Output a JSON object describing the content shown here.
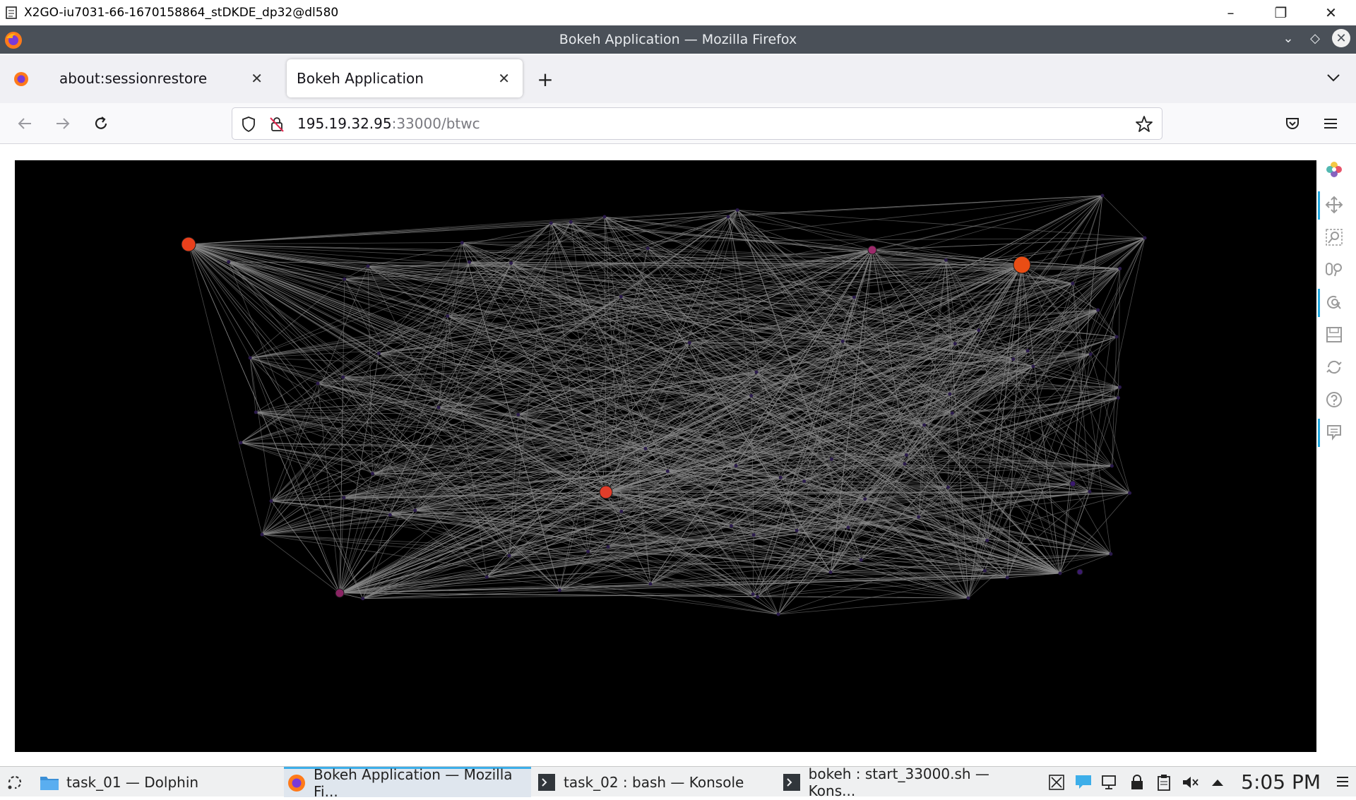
{
  "x2go": {
    "title": "X2GO-iu7031-66-1670158864_stDKDE_dp32@dl580",
    "controls": [
      "–",
      "❐",
      "✕"
    ]
  },
  "window": {
    "title": "Bokeh Application — Mozilla Firefox"
  },
  "tabs": [
    {
      "label": "about:sessionrestore",
      "active": false
    },
    {
      "label": "Bokeh Application",
      "active": true
    }
  ],
  "new_tab_symbol": "+",
  "nav": {
    "url_host": "195.19.32.95",
    "url_rest": ":33000/btwc"
  },
  "plot": {
    "background": "#000000",
    "edge_color": "#8a8a8a",
    "nodes": [
      {
        "color": "#e8401c",
        "kind": "large-orange"
      },
      {
        "color": "#ea4d14",
        "kind": "large-orange"
      },
      {
        "color": "#e03d2a",
        "kind": "red"
      },
      {
        "color": "#9b2a6a",
        "kind": "purple"
      },
      {
        "color": "#8a2463",
        "kind": "purple"
      },
      {
        "color": "#3b1a6e",
        "kind": "dark-purple"
      }
    ],
    "toolbar": [
      "bokeh-logo",
      "pan",
      "box-zoom",
      "wheel-zoom",
      "reset-zoom",
      "save",
      "reset",
      "help",
      "hover"
    ]
  },
  "taskbar": {
    "tasks": [
      {
        "label": "task_01 — Dolphin",
        "icon": "folder-icon",
        "active": false
      },
      {
        "label": "Bokeh Application — Mozilla Fi...",
        "icon": "firefox-icon",
        "active": true
      },
      {
        "label": "task_02 : bash — Konsole",
        "icon": "terminal-icon",
        "active": false
      },
      {
        "label": "bokeh : start_33000.sh — Kons...",
        "icon": "terminal-icon",
        "active": false
      }
    ],
    "clock": "5:05 PM"
  }
}
